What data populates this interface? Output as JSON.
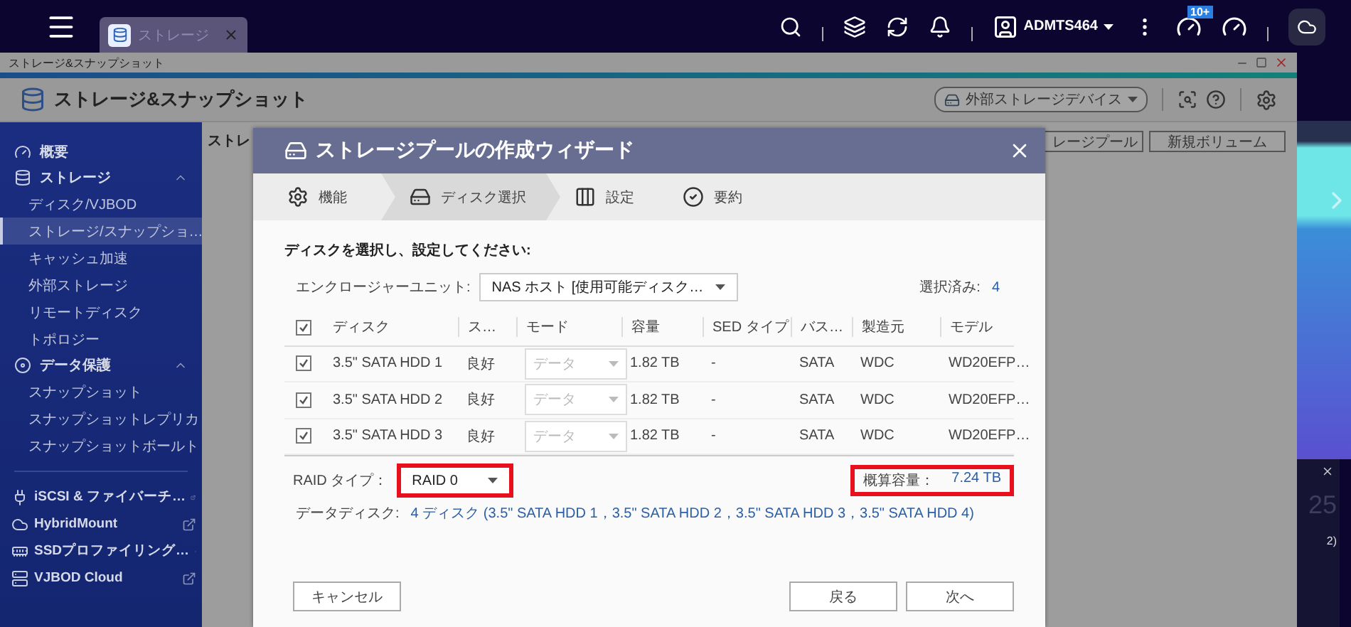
{
  "top_bar": {
    "tab": {
      "label": "ストレージ"
    },
    "user": "ADMTS464",
    "notification_badge": "10+"
  },
  "app_window": {
    "title": "ストレージ&スナップショット",
    "header_title": "ストレージ&スナップショット",
    "device_dropdown": "外部ストレージデバイス",
    "sidebar": [
      {
        "kind": "top",
        "label": "概要"
      },
      {
        "kind": "group",
        "label": "ストレージ",
        "expanded": true,
        "children": [
          {
            "label": "ディスク/VJBOD",
            "selected": false
          },
          {
            "label": "ストレージ/スナップショ…",
            "selected": true
          },
          {
            "label": "キャッシュ加速",
            "selected": false
          },
          {
            "label": "外部ストレージ",
            "selected": false
          },
          {
            "label": "リモートディスク",
            "selected": false
          },
          {
            "label": "トポロジー",
            "selected": false
          }
        ]
      },
      {
        "kind": "group",
        "label": "データ保護",
        "expanded": true,
        "children": [
          {
            "label": "スナップショット",
            "selected": false
          },
          {
            "label": "スナップショットレプリカ",
            "selected": false
          },
          {
            "label": "スナップショットボールト",
            "selected": false
          }
        ]
      },
      {
        "kind": "external",
        "label": "iSCSI & ファイバーチ…"
      },
      {
        "kind": "external",
        "label": "HybridMount"
      },
      {
        "kind": "external",
        "label": "SSDプロファイリング…"
      },
      {
        "kind": "external",
        "label": "VJBOD Cloud"
      }
    ],
    "page_title": "ストレ",
    "page_buttons": [
      "レージプール",
      "新規ボリューム"
    ]
  },
  "dialog": {
    "title": "ストレージプールの作成ウィザード",
    "steps": [
      {
        "label": "機能",
        "selected": false
      },
      {
        "label": "ディスク選択",
        "selected": true
      },
      {
        "label": "設定",
        "selected": false
      },
      {
        "label": "要約",
        "selected": false
      }
    ],
    "instruction": "ディスクを選択し、設定してください:",
    "enclosure": {
      "label": "エンクロージャーユニット:",
      "value": "NAS ホスト [使用可能ディスク…"
    },
    "selected_count": {
      "label": "選択済み:",
      "value": "4"
    },
    "table": {
      "select_all_checked": true,
      "columns": [
        "ディスク",
        "ス…",
        "モード",
        "容量",
        "SED タイプ",
        "バス…",
        "製造元",
        "モデル"
      ],
      "rows": [
        {
          "checked": true,
          "disk": "3.5\" SATA HDD 1",
          "status": "良好",
          "mode": {
            "value": "データ",
            "disabled": true
          },
          "capacity": "1.82 TB",
          "sed": "-",
          "bus": "SATA",
          "maker": "WDC",
          "model": "WD20EFP…"
        },
        {
          "checked": true,
          "disk": "3.5\" SATA HDD 2",
          "status": "良好",
          "mode": {
            "value": "データ",
            "disabled": true
          },
          "capacity": "1.82 TB",
          "sed": "-",
          "bus": "SATA",
          "maker": "WDC",
          "model": "WD20EFP…"
        },
        {
          "checked": true,
          "disk": "3.5\" SATA HDD 3",
          "status": "良好",
          "mode": {
            "value": "データ",
            "disabled": true
          },
          "capacity": "1.82 TB",
          "sed": "-",
          "bus": "SATA",
          "maker": "WDC",
          "model": "WD20EFP…"
        }
      ]
    },
    "raid_type": {
      "label": "RAID タイプ：",
      "value": "RAID 0",
      "highlighted": true
    },
    "estimated_capacity": {
      "label": "概算容量：",
      "value": "7.24 TB",
      "highlighted": true
    },
    "data_disks": {
      "label": "データディスク:",
      "value": "4 ディスク (3.5\" SATA HDD 1，3.5\" SATA HDD 2，3.5\" SATA HDD 3，3.5\" SATA HDD 4)"
    },
    "buttons": {
      "cancel": "キャンセル",
      "back": "戻る",
      "next": "次へ"
    }
  },
  "desktop_notification": {
    "number": "25",
    "text": "2)"
  }
}
